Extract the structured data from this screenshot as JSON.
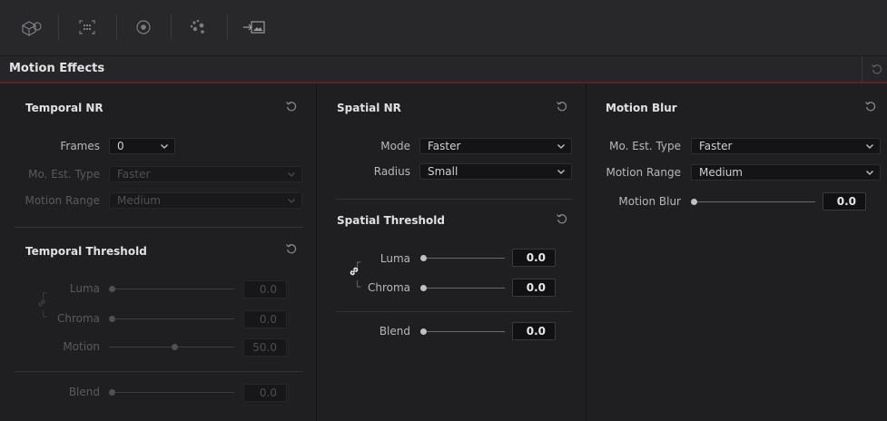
{
  "section_title": "Motion Effects",
  "toolbar": {
    "icons": [
      "3d-motion-icon",
      "grid-icon",
      "target-icon",
      "dots-cluster-icon",
      "image-export-icon"
    ]
  },
  "temporal_nr": {
    "title": "Temporal NR",
    "frames_label": "Frames",
    "frames_value": "0",
    "mo_est_label": "Mo. Est. Type",
    "mo_est_value": "Faster",
    "motion_range_label": "Motion Range",
    "motion_range_value": "Medium"
  },
  "temporal_threshold": {
    "title": "Temporal Threshold",
    "luma_label": "Luma",
    "luma_value": "0.0",
    "chroma_label": "Chroma",
    "chroma_value": "0.0",
    "motion_label": "Motion",
    "motion_value": "50.0",
    "blend_label": "Blend",
    "blend_value": "0.0"
  },
  "spatial_nr": {
    "title": "Spatial NR",
    "mode_label": "Mode",
    "mode_value": "Faster",
    "radius_label": "Radius",
    "radius_value": "Small"
  },
  "spatial_threshold": {
    "title": "Spatial Threshold",
    "luma_label": "Luma",
    "luma_value": "0.0",
    "chroma_label": "Chroma",
    "chroma_value": "0.0",
    "blend_label": "Blend",
    "blend_value": "0.0"
  },
  "motion_blur": {
    "title": "Motion Blur",
    "mo_est_label": "Mo. Est. Type",
    "mo_est_value": "Faster",
    "motion_range_label": "Motion Range",
    "motion_range_value": "Medium",
    "blur_label": "Motion Blur",
    "blur_value": "0.0"
  },
  "colors": {
    "background": "#1e1e20",
    "accent_line": "#5a2224"
  }
}
